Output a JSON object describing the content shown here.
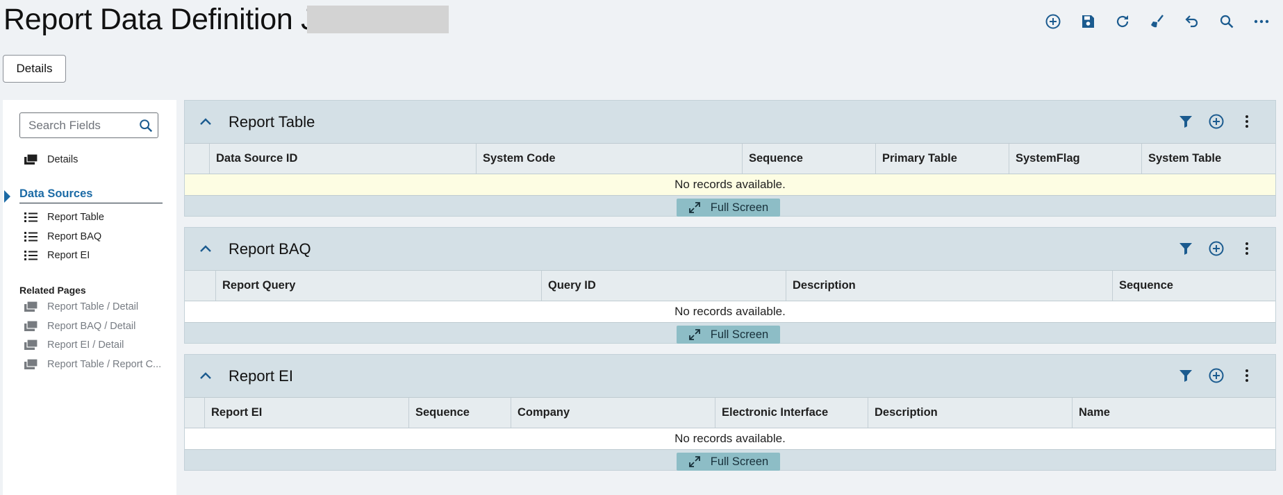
{
  "header": {
    "title": "Report Data Definition JT",
    "toolbar": [
      {
        "name": "add-new-icon"
      },
      {
        "name": "save-icon"
      },
      {
        "name": "refresh-icon"
      },
      {
        "name": "clear-icon"
      },
      {
        "name": "undo-icon"
      },
      {
        "name": "search-icon"
      },
      {
        "name": "more-options-icon"
      }
    ]
  },
  "tabs": {
    "details": "Details"
  },
  "sidebar": {
    "search_placeholder": "Search Fields",
    "details_label": "Details",
    "data_sources_label": "Data Sources",
    "data_sources": [
      "Report Table",
      "Report BAQ",
      "Report EI"
    ],
    "related_label": "Related Pages",
    "related": [
      "Report Table / Detail",
      "Report BAQ / Detail",
      "Report EI / Detail",
      "Report Table / Report C..."
    ]
  },
  "panels": [
    {
      "title": "Report Table",
      "columns": [
        "Data Source ID",
        "System Code",
        "Sequence",
        "Primary Table",
        "SystemFlag",
        "System Table"
      ],
      "empty_text": "No records available.",
      "fullscreen_label": "Full Screen"
    },
    {
      "title": "Report BAQ",
      "columns": [
        "Report Query",
        "Query ID",
        "Description",
        "Sequence"
      ],
      "empty_text": "No records available.",
      "fullscreen_label": "Full Screen"
    },
    {
      "title": "Report EI",
      "columns": [
        "Report EI",
        "Sequence",
        "Company",
        "Electronic Interface",
        "Description",
        "Name"
      ],
      "empty_text": "No records available.",
      "fullscreen_label": "Full Screen"
    }
  ],
  "colors": {
    "accent": "#1b6aa5",
    "panel_bg": "#d4e0e6",
    "empty_highlight": "#fdfde3",
    "fullscreen_bg": "#8dbdc6"
  }
}
